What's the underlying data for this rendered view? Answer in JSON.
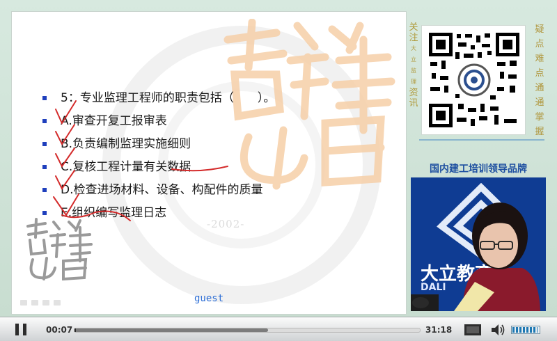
{
  "slide": {
    "question": [
      "5：专业监理工程师的职责包括（　　）。",
      "A.审查开复工报审表",
      "B.负责编制监理实施细则",
      "C.复核工程计量有关数据",
      "D.检查进场材料、设备、构配件的质量",
      "E.组织编写监理日志"
    ],
    "watermark_year": "-2002-",
    "overlay_user": "guest"
  },
  "sidebar": {
    "follow_big_top": [
      "关",
      "注"
    ],
    "follow_small": [
      "大",
      "立",
      "监",
      "理"
    ],
    "follow_big_bottom": [
      "资",
      "讯"
    ],
    "hints": [
      "疑",
      "点",
      "难",
      "点",
      "通",
      "通",
      "掌",
      "握"
    ],
    "brand": "国内建工培训领导品牌",
    "video_title": "大立教育",
    "video_sub": "DALI"
  },
  "controls": {
    "current_time": "00:07",
    "total_time": "31:18",
    "progress_fraction": 0.004,
    "buffered_fraction": 0.56,
    "volume_fraction": 0.95
  },
  "colors": {
    "bullet": "#1f3fbd",
    "annotation": "#d42b2b",
    "watermark": "#f6d2b0",
    "accent_gold": "#b09a3c",
    "brand_blue": "#1c4ea0"
  }
}
